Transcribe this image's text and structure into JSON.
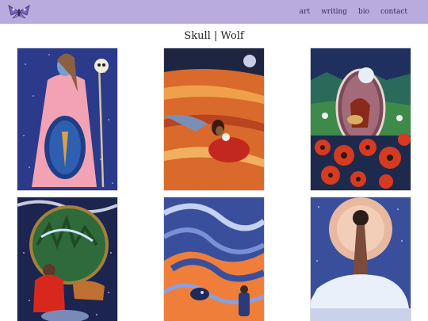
{
  "nav": {
    "logo_icon": "moth-logo-icon",
    "items": [
      {
        "label": "art"
      },
      {
        "label": "writing"
      },
      {
        "label": "bio"
      },
      {
        "label": "contact"
      }
    ]
  },
  "page": {
    "title": "Skull | Wolf"
  },
  "gallery": {
    "items": [
      {
        "name": "painting-woman-with-skull-staff"
      },
      {
        "name": "painting-woman-in-field-with-skull"
      },
      {
        "name": "painting-figure-in-oval-with-poppies"
      },
      {
        "name": "painting-person-in-red-hoodie-forest"
      },
      {
        "name": "painting-swirling-blue-figure"
      },
      {
        "name": "painting-figure-with-polar-bear"
      }
    ]
  },
  "colors": {
    "nav_bg": "#b9abdd",
    "nav_text": "#3a2a63"
  }
}
